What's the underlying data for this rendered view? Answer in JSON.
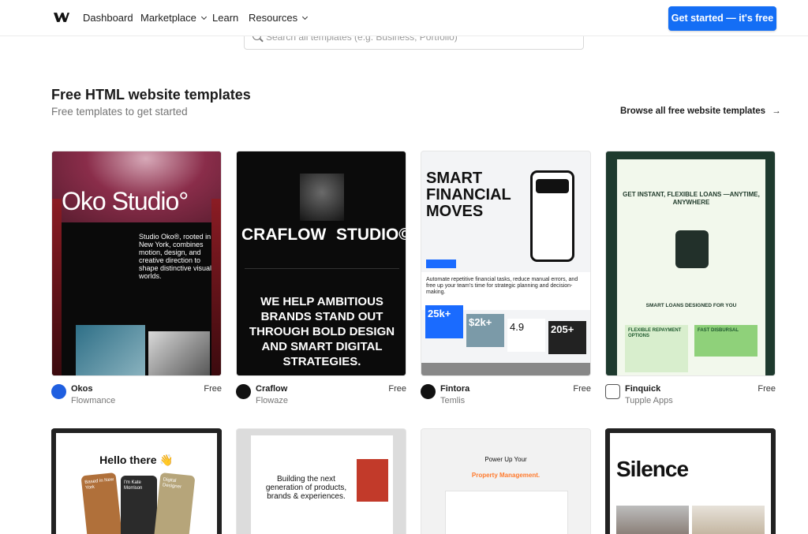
{
  "nav": {
    "links": [
      "Dashboard",
      "Marketplace",
      "Learn",
      "Resources"
    ],
    "cta": "Get started — it's free"
  },
  "search": {
    "placeholder": "Search all templates (e.g. Business, Portfolio)"
  },
  "section": {
    "title": "Free HTML website templates",
    "subtitle": "Free templates to get started",
    "browse": "Browse all free website templates",
    "browse_arrow": "→"
  },
  "templates": [
    {
      "name": "Okos",
      "author": "Flowmance",
      "price": "Free",
      "brand_color": "#1f5fe0",
      "preview": {
        "title": "Oko Studio°",
        "text": "Studio Oko®, rooted in New York, combines motion, design, and creative direction to shape distinctive visual worlds."
      }
    },
    {
      "name": "Craflow",
      "author": "Flowaze",
      "price": "Free",
      "brand_color": "#111111",
      "preview": {
        "left": "CRAFLOW",
        "right": "STUDIO©",
        "slogan": "WE HELP AMBITIOUS BRANDS STAND OUT THROUGH BOLD DESIGN AND SMART DIGITAL STRATEGIES."
      }
    },
    {
      "name": "Fintora",
      "author": "Temlis",
      "price": "Free",
      "brand_color": "#111111",
      "preview": {
        "title": "SMART FINANCIAL MOVES",
        "text": "Automate repetitive financial tasks, reduce manual errors, and free up your team's time for strategic planning and decision-making.",
        "stats": [
          "25k+",
          "$2k+",
          "4.9",
          "205+"
        ]
      }
    },
    {
      "name": "Finquick",
      "author": "Tupple Apps",
      "price": "Free",
      "brand_color": "#555555",
      "preview": {
        "title": "GET INSTANT, FLEXIBLE LOANS —ANYTIME, ANYWHERE",
        "sub": "SMART LOANS DESIGNED FOR YOU",
        "tile1": "FLEXIBLE REPAYMENT OPTIONS",
        "tile2": "FAST DISBURSAL"
      }
    }
  ],
  "row2": [
    {
      "preview": {
        "title": "Hello there 👋",
        "c1": "Based in New York",
        "c2": "I'm Kate Morrison",
        "c3": "Digital Designer"
      }
    },
    {
      "preview": {
        "title": "Building the next generation of products, brands & experiences."
      }
    },
    {
      "preview": {
        "title": "Power Up Your",
        "accent": "Property Management."
      }
    },
    {
      "preview": {
        "title": "Silence"
      }
    }
  ],
  "colors": {
    "accent": "#146ef5"
  }
}
